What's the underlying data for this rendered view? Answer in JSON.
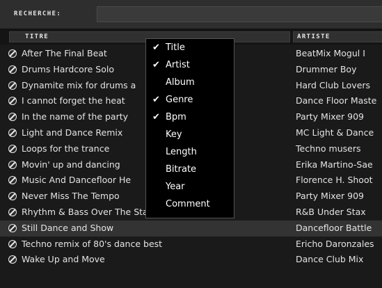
{
  "search": {
    "label": "RECHERCHE:",
    "value": ""
  },
  "columns": {
    "title": "TITRE",
    "artist": "ARTISTE"
  },
  "rows": [
    {
      "title": "After The Final Beat",
      "artist": "BeatMix Mogul I"
    },
    {
      "title": "Drums Hardcore Solo",
      "artist": "Drummer Boy"
    },
    {
      "title": "Dynamite mix for drums a",
      "artist": "Hard Club Lovers"
    },
    {
      "title": "I cannot forget the heat",
      "artist": "Dance Floor Maste"
    },
    {
      "title": "In the name of the party",
      "artist": "Party Mixer 909"
    },
    {
      "title": "Light and Dance Remix",
      "artist": "MC Light & Dance"
    },
    {
      "title": "Loops for the trance",
      "artist": "Techno musers"
    },
    {
      "title": "Movin' up and dancing",
      "artist": "Erika Martino-Sae"
    },
    {
      "title": "Music And Dancefloor He",
      "artist": "Florence H. Shoot"
    },
    {
      "title": "Never Miss The Tempo",
      "artist": "Party Mixer 909"
    },
    {
      "title": "Rhythm & Bass Over The Stage",
      "artist": "R&B Under Stax"
    },
    {
      "title": "Still Dance and Show",
      "artist": "Dancefloor Battle"
    },
    {
      "title": "Techno remix of 80's dance best",
      "artist": "Ericho Daronzales"
    },
    {
      "title": "Wake Up and Move",
      "artist": "Dance Club Mix"
    }
  ],
  "highlighted_row": "Still Dance and Show",
  "column_menu": {
    "check_glyph": "✔",
    "items": [
      {
        "label": "Title",
        "checked": true
      },
      {
        "label": "Artist",
        "checked": true
      },
      {
        "label": "Album",
        "checked": false
      },
      {
        "label": "Genre",
        "checked": true
      },
      {
        "label": "Bpm",
        "checked": true
      },
      {
        "label": "Key",
        "checked": false
      },
      {
        "label": "Length",
        "checked": false
      },
      {
        "label": "Bitrate",
        "checked": false
      },
      {
        "label": "Year",
        "checked": false
      },
      {
        "label": "Comment",
        "checked": false
      }
    ]
  },
  "icons": {
    "row": "vinyl-disc-icon",
    "check": "checkmark-icon"
  },
  "colors": {
    "background": "#1a1a1a",
    "highlight": "#333333",
    "menu_bg": "#000000"
  }
}
